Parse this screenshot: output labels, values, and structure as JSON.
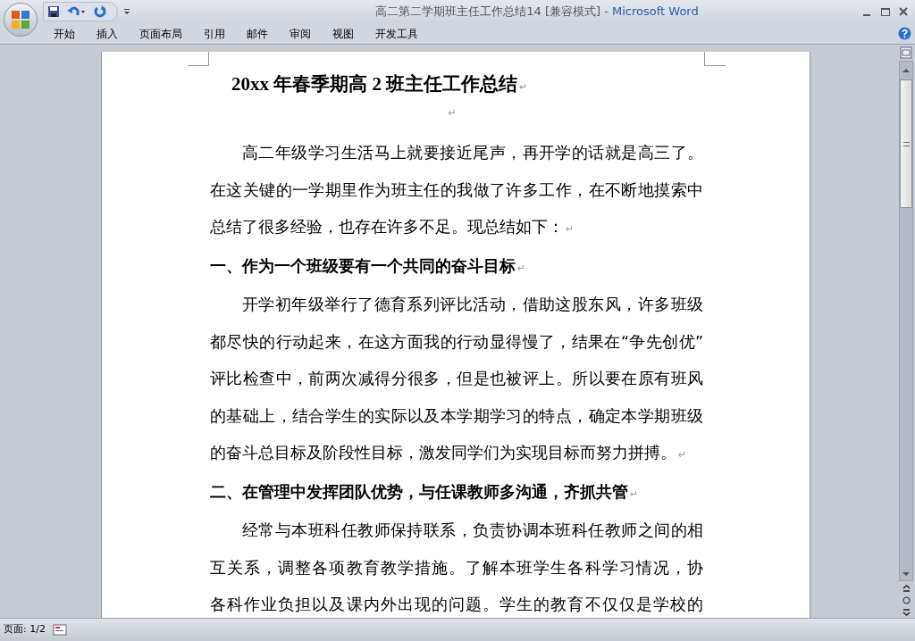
{
  "window": {
    "doc_title": "高二第二学期班主任工作总结14 [兼容模式]",
    "app_name": " - Microsoft Word"
  },
  "ribbon_tabs": [
    {
      "label": "开始",
      "selected": false
    },
    {
      "label": "插入",
      "selected": false
    },
    {
      "label": "页面布局",
      "selected": false
    },
    {
      "label": "引用",
      "selected": false
    },
    {
      "label": "邮件",
      "selected": false
    },
    {
      "label": "审阅",
      "selected": false
    },
    {
      "label": "视图",
      "selected": false
    },
    {
      "label": "开发工具",
      "selected": false
    }
  ],
  "document": {
    "paragraphs": [
      {
        "kind": "title",
        "lines": [
          "20xx 年春季期高 2 班主任工作总结"
        ],
        "mark": "↵"
      },
      {
        "kind": "empty",
        "mark": "↵"
      },
      {
        "kind": "body",
        "lines": [
          "高二年级学习生活马上就要接近尾声，再开学的话就是高三了。",
          "在这关键的一学期里作为班主任的我做了许多工作，在不断地摸索中",
          "总结了很多经验，也存在许多不足。现总结如下："
        ],
        "mark": "↵"
      },
      {
        "kind": "heading",
        "lines": [
          "一、作为一个班级要有一个共同的奋斗目标"
        ],
        "mark": "↵"
      },
      {
        "kind": "body",
        "lines": [
          "开学初年级举行了德育系列评比活动，借助这股东风，许多班级",
          "都尽快的行动起来，在这方面我的行动显得慢了，结果在“争先创优”",
          "评比检查中，前两次减得分很多，但是也被评上。所以要在原有班风",
          "的基础上，结合学生的实际以及本学期学习的特点，确定本学期班级",
          "的奋斗总目标及阶段性目标，激发同学们为实现目标而努力拼搏。"
        ],
        "mark": "↵"
      },
      {
        "kind": "heading",
        "lines": [
          "二、在管理中发挥团队优势，与任课教师多沟通，齐抓共管"
        ],
        "mark": "↵"
      },
      {
        "kind": "body_cut",
        "lines": [
          "经常与本班科任教师保持联系，负责协调本班科任教师之间的相",
          "互关系，调整各项教育教学措施。了解本班学生各科学习情况，协",
          "各科作业负担以及课内外出现的问题。学生的教育不仅仅是学校的"
        ]
      }
    ]
  },
  "status_bar": {
    "page": "页面: 1/2"
  }
}
